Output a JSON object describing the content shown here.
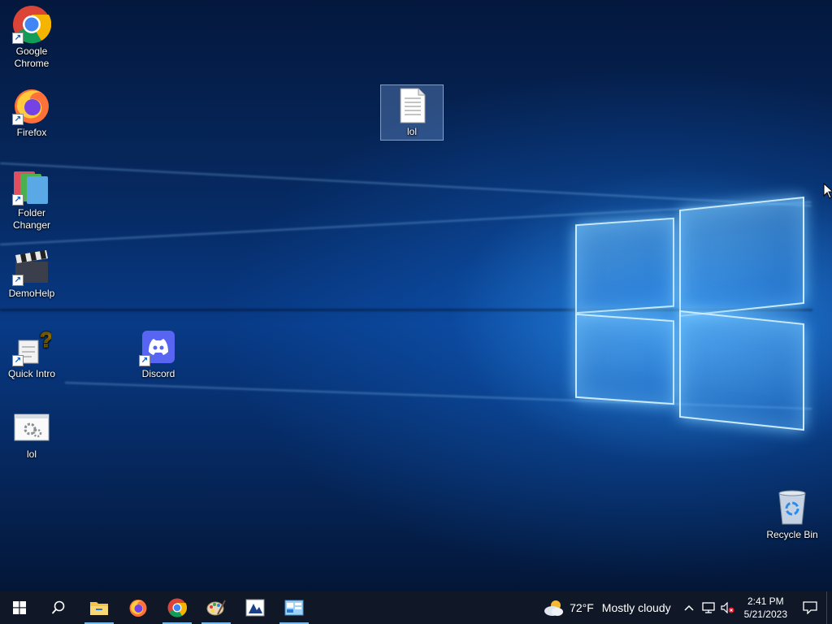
{
  "desktop": {
    "icons": [
      {
        "label": "Google\nChrome",
        "icon": "chrome-icon"
      },
      {
        "label": "Firefox",
        "icon": "firefox-icon"
      },
      {
        "label": "Folder\nChanger",
        "icon": "folder-changer-icon"
      },
      {
        "label": "DemoHelp",
        "icon": "clapperboard-icon"
      },
      {
        "label": "Quick Intro",
        "icon": "help-document-icon"
      },
      {
        "label": "lol",
        "icon": "settings-window-icon"
      },
      {
        "label": "Discord",
        "icon": "discord-icon"
      },
      {
        "label": "lol",
        "icon": "text-document-icon",
        "selected": true
      },
      {
        "label": "Recycle Bin",
        "icon": "recycle-bin-icon"
      }
    ]
  },
  "taskbar": {
    "apps": [
      {
        "name": "start",
        "icon": "windows-start-icon"
      },
      {
        "name": "search",
        "icon": "search-icon"
      },
      {
        "name": "file-explorer",
        "icon": "folder-icon",
        "active": true
      },
      {
        "name": "firefox",
        "icon": "firefox-icon"
      },
      {
        "name": "chrome",
        "icon": "chrome-icon",
        "active": true
      },
      {
        "name": "paint",
        "icon": "paint-palette-icon",
        "active": true
      },
      {
        "name": "app-1",
        "icon": "image-app-icon"
      },
      {
        "name": "app-2",
        "icon": "control-panel-icon",
        "active": true
      }
    ],
    "weather": {
      "temp": "72°F",
      "condition": "Mostly cloudy",
      "icon": "cloud-sun-icon"
    },
    "clock": {
      "time": "2:41 PM",
      "date": "5/21/2023"
    },
    "tray_icons": [
      "chevron-up-icon",
      "network-icon",
      "volume-muted-icon"
    ],
    "notification_icon": "action-center-icon"
  },
  "colors": {
    "taskbar": "#101828",
    "accent": "#76b9ed"
  }
}
